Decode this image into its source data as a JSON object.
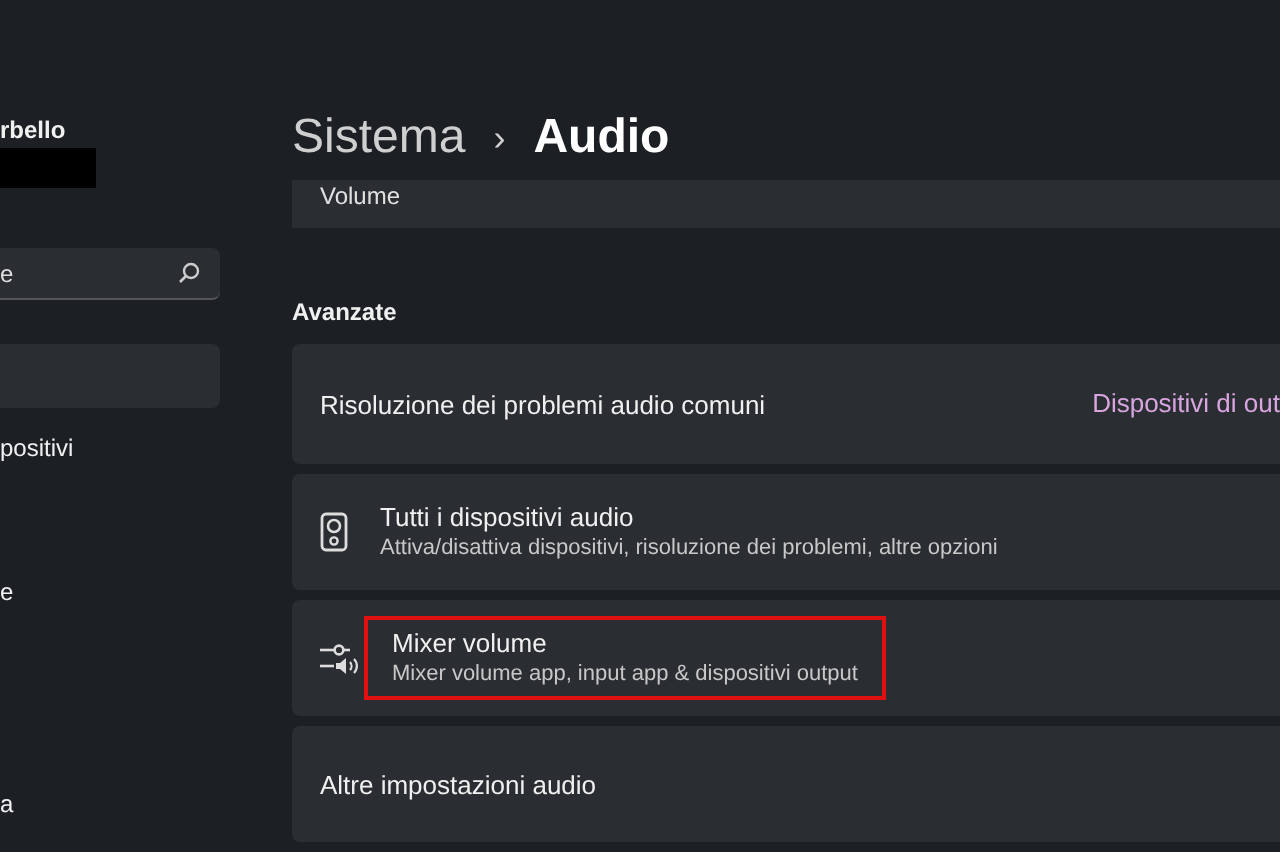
{
  "sidebar": {
    "user_name": "rbello",
    "search": {
      "placeholder": "e"
    },
    "items": [
      {
        "selected": true
      },
      {
        "label": "positivi",
        "selected": false
      },
      {
        "label": "e",
        "selected": false
      },
      {
        "label": "a",
        "selected": false
      }
    ]
  },
  "breadcrumb": {
    "parent": "Sistema",
    "separator": "›",
    "current": "Audio"
  },
  "volume_card": {
    "label": "Volume"
  },
  "section_title": "Avanzate",
  "cards": [
    {
      "kind": "link",
      "title": "Risoluzione dei problemi audio comuni",
      "action": "Dispositivi di out"
    },
    {
      "kind": "speaker",
      "title": "Tutti i dispositivi audio",
      "subtitle": "Attiva/disattiva dispositivi, risoluzione dei problemi, altre opzioni",
      "highlighted": false
    },
    {
      "kind": "mixer",
      "title": "Mixer volume",
      "subtitle": "Mixer volume app, input app & dispositivi output",
      "highlighted": true
    },
    {
      "kind": "plain",
      "title": "Altre impostazioni audio"
    }
  ]
}
